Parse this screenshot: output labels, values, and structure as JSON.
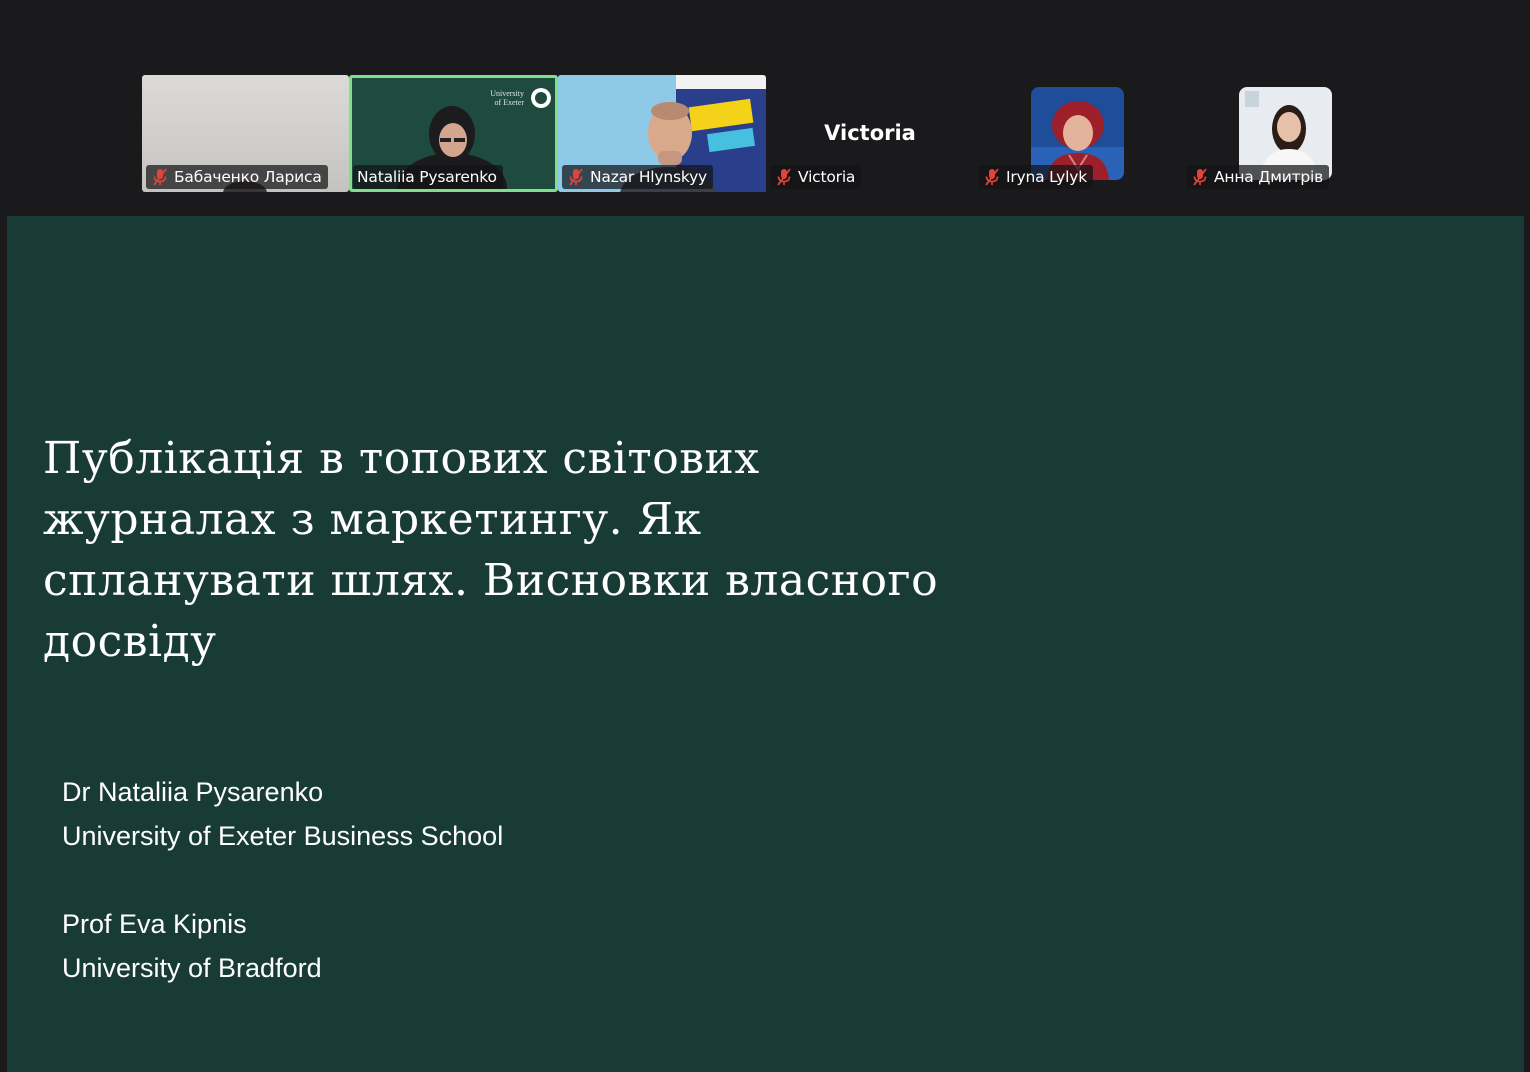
{
  "participants": [
    {
      "name": "Бабаченко Лариса",
      "muted": true,
      "type": "video"
    },
    {
      "name": "Nataliia Pysarenko",
      "muted": false,
      "type": "video",
      "active_speaker": true,
      "background_logo_text": "University of Exeter"
    },
    {
      "name": "Nazar Hlynskyy",
      "muted": true,
      "type": "video"
    },
    {
      "name": "Victoria",
      "muted": true,
      "type": "name-only",
      "display_name": "Victoria"
    },
    {
      "name": "Iryna Lylyk",
      "muted": true,
      "type": "avatar"
    },
    {
      "name": "Анна Дмитрів",
      "muted": true,
      "type": "avatar"
    }
  ],
  "slide": {
    "title": "Публікація в топових світових журналах з маркетингу. Як спланувати шлях. Висновки власного досвіду",
    "authors": [
      {
        "name": "Dr Nataliia Pysarenko",
        "affiliation": "University of Exeter Business School"
      },
      {
        "name": "Prof Eva Kipnis",
        "affiliation": "University of Bradford"
      }
    ]
  },
  "colors": {
    "app_background": "#1a1a1c",
    "slide_background": "#193b36",
    "active_speaker_border": "#7ee08a",
    "muted_icon": "#e0443a"
  }
}
